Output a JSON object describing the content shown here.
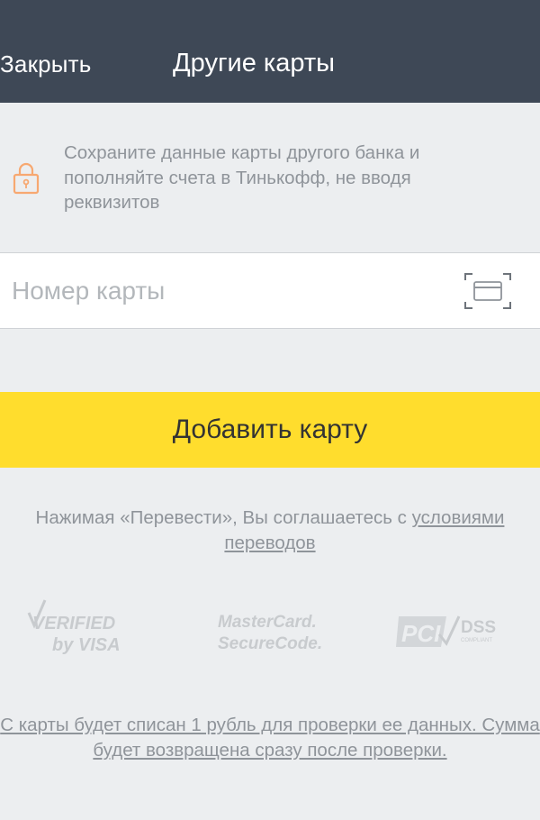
{
  "header": {
    "close_label": "Закрыть",
    "title": "Другие карты"
  },
  "info": {
    "text": "Сохраните данные карты другого банка и пополняйте счета в Тинькофф, не вводя реквизитов"
  },
  "card_input": {
    "placeholder": "Номер карты",
    "value": ""
  },
  "add_button": {
    "label": "Добавить карту"
  },
  "terms": {
    "prefix": "Нажимая «Перевести», Вы соглашаетесь с ",
    "link": "условиями переводов"
  },
  "logos": {
    "visa_line1": "VERIFIED",
    "visa_line2": "by VISA",
    "mc_line1": "MasterCard.",
    "mc_line2": "SecureCode.",
    "pci_mark": "PCI",
    "pci_dss": "DSS",
    "pci_sub": "COMPLIANT"
  },
  "bottom_note": "С карты будет списан 1 рубль для проверки ее данных. Сумма будет возвращена сразу после проверки.",
  "colors": {
    "header_bg": "#3e4856",
    "accent_yellow": "#ffdd2d",
    "lock_orange": "#f7a871",
    "page_bg": "#eceef0"
  }
}
